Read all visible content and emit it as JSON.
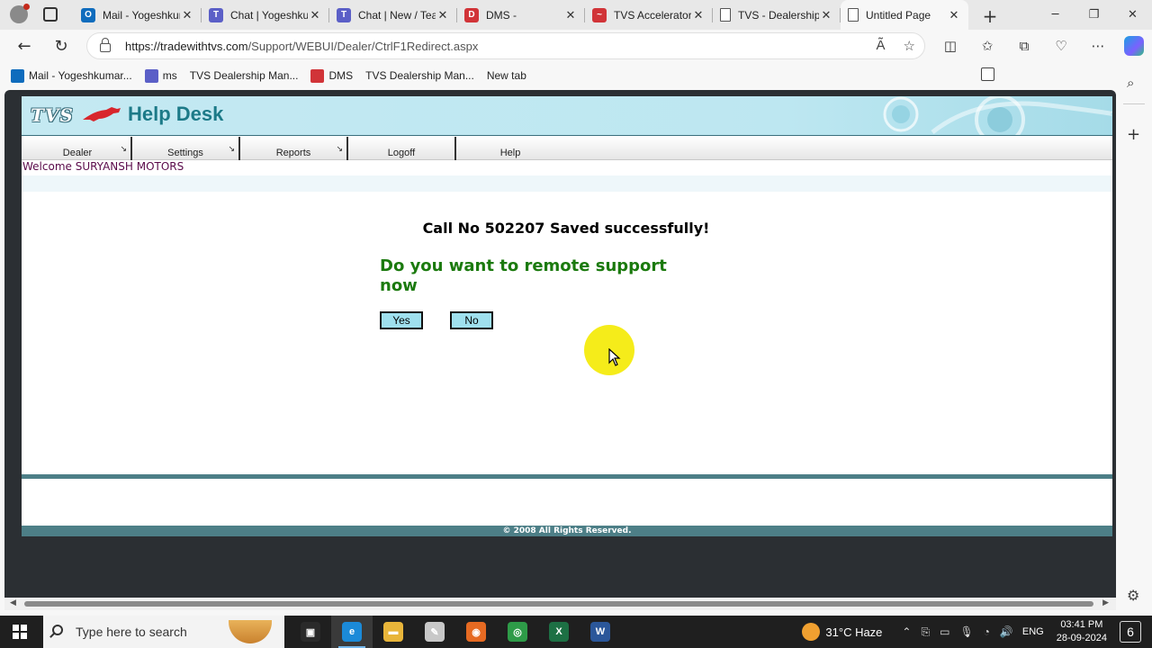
{
  "browser": {
    "tabs": [
      {
        "title": "Mail - Yogeshkumar",
        "icon": "outlook-icon",
        "color": "#0f6cbd",
        "glyph": "O"
      },
      {
        "title": "Chat | Yogeshkumar",
        "icon": "teams-icon",
        "color": "#5b5fc7",
        "glyph": "T"
      },
      {
        "title": "Chat | New / Teams",
        "icon": "teams-icon",
        "color": "#5b5fc7",
        "glyph": "T"
      },
      {
        "title": "DMS -",
        "icon": "dms-icon",
        "color": "#d13438",
        "glyph": "D"
      },
      {
        "title": "TVS Accelerator",
        "icon": "tvs-icon",
        "color": "#d13438",
        "glyph": "~"
      },
      {
        "title": "TVS - Dealership",
        "icon": "page-icon",
        "color": "#ffffff",
        "glyph": ""
      },
      {
        "title": "Untitled Page",
        "icon": "page-icon",
        "color": "#ffffff",
        "glyph": "",
        "active": true
      }
    ],
    "url_host": "https://tradewithtvs.com",
    "url_path": "/Support/WEBUI/Dealer/CtrlF1Redirect.aspx",
    "bookmarks": [
      {
        "label": "Mail - Yogeshkumar...",
        "icon": "outlook"
      },
      {
        "label": "ms",
        "icon": "teams"
      },
      {
        "label": "TVS Dealership Man...",
        "icon": "page"
      },
      {
        "label": "DMS",
        "icon": "dms"
      },
      {
        "label": "TVS Dealership Man...",
        "icon": "page"
      },
      {
        "label": "New tab",
        "icon": "newtab"
      }
    ]
  },
  "helpdesk": {
    "logo_brand": "TVS",
    "logo_title": "Help Desk",
    "menu": [
      {
        "label": "Dealer",
        "has_submenu": true
      },
      {
        "label": "Settings",
        "has_submenu": true
      },
      {
        "label": "Reports",
        "has_submenu": true
      },
      {
        "label": "Logoff",
        "has_submenu": false
      },
      {
        "label": "Help",
        "has_submenu": false
      }
    ],
    "welcome": "Welcome SURYANSH MOTORS",
    "saved_message": "Call No 502207 Saved successfully!",
    "question": "Do you want to remote support now",
    "yes_label": "Yes",
    "no_label": "No",
    "footer": "© 2008 All Rights Reserved.",
    "accent_color": "#1b7a0e",
    "button_color": "#9fe0ee"
  },
  "taskbar": {
    "search_placeholder": "Type here to search",
    "weather": "31°C  Haze",
    "language": "ENG",
    "time": "03:41 PM",
    "date": "28-09-2024",
    "notification_count": "6",
    "apps": [
      {
        "name": "task-view-icon",
        "color": "#2a2a2a",
        "glyph": "▣"
      },
      {
        "name": "edge-icon",
        "color": "#1b8ad8",
        "glyph": "e",
        "active": true
      },
      {
        "name": "file-explorer-icon",
        "color": "#e8b53a",
        "glyph": "▬"
      },
      {
        "name": "paint-icon",
        "color": "#c8c8c8",
        "glyph": "✎"
      },
      {
        "name": "firefox-icon",
        "color": "#e66a22",
        "glyph": "◉"
      },
      {
        "name": "chrome-icon",
        "color": "#2e9b48",
        "glyph": "◎"
      },
      {
        "name": "excel-icon",
        "color": "#1d7044",
        "glyph": "X"
      },
      {
        "name": "word-icon",
        "color": "#2b579a",
        "glyph": "W"
      }
    ]
  }
}
